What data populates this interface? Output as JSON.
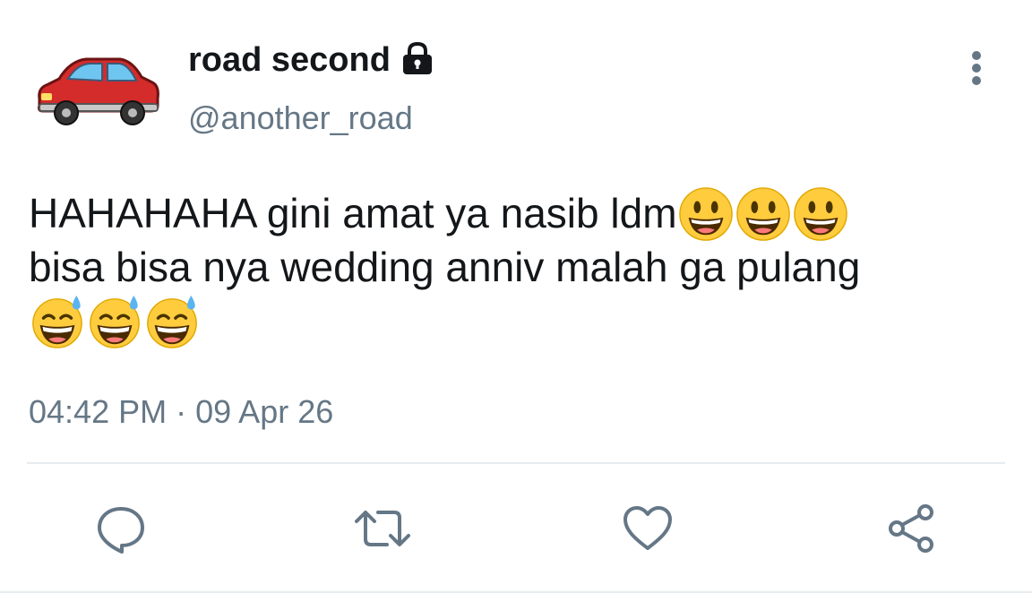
{
  "author": {
    "display_name": "road second",
    "handle": "@another_road",
    "avatar_icon": "red-car-icon",
    "protected_icon": "lock-icon"
  },
  "tweet": {
    "line1": "HAHAHAHA gini amat ya nasib ldm",
    "line1_emoji_count": 3,
    "line1_emoji": "grinning-face",
    "line2": "bisa bisa nya wedding anniv malah ga pulang",
    "line3_emoji_count": 3,
    "line3_emoji": "grinning-face-with-sweat"
  },
  "timestamp": {
    "time": "04:42 PM",
    "separator": "·",
    "date": "09 Apr 26"
  },
  "actions": [
    {
      "icon": "reply-icon"
    },
    {
      "icon": "retweet-icon"
    },
    {
      "icon": "like-icon"
    },
    {
      "icon": "share-icon"
    }
  ],
  "colors": {
    "text": "#14171a",
    "secondary": "#657786",
    "divider": "#e6ecf0"
  }
}
